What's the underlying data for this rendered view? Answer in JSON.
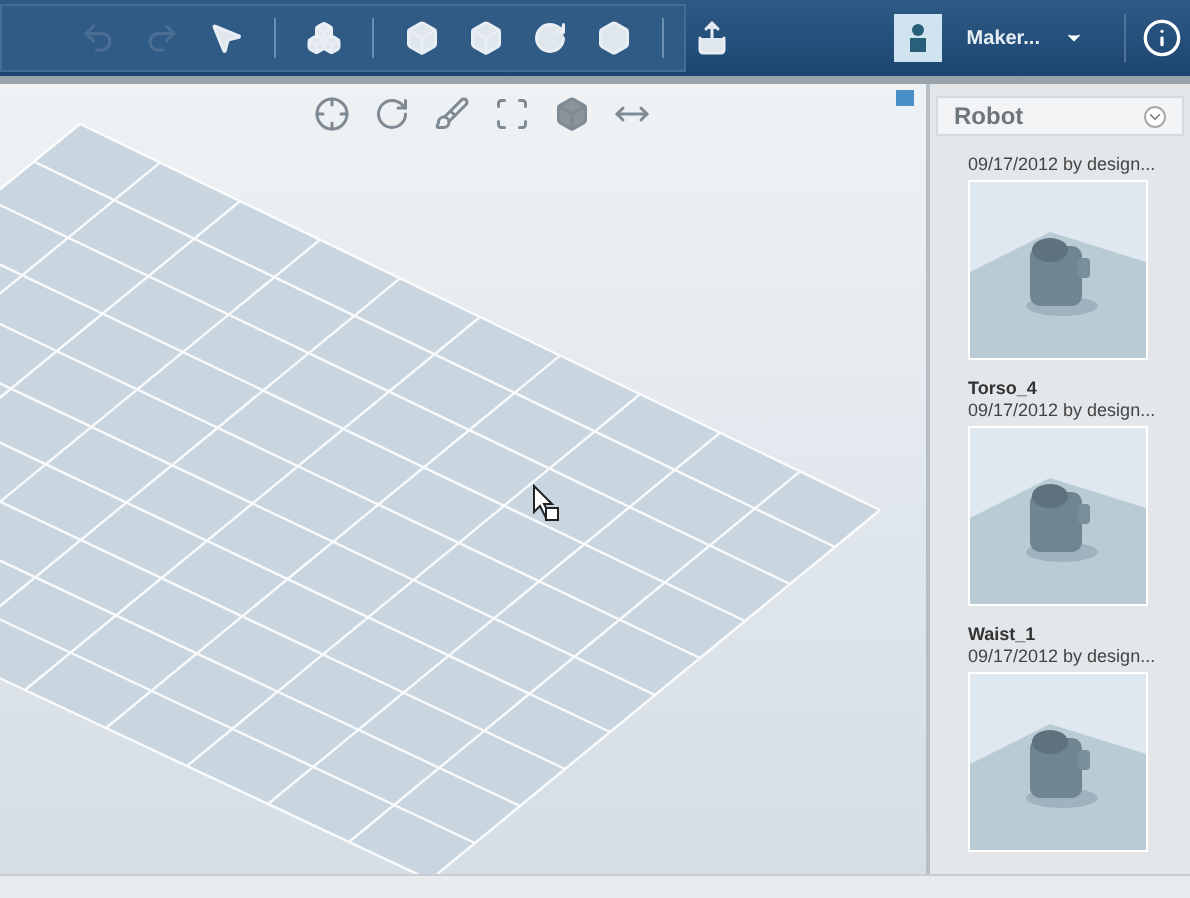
{
  "toolbar": {
    "tools": [
      {
        "kind": "undo",
        "disabled": true
      },
      {
        "kind": "redo",
        "disabled": true
      },
      {
        "kind": "select",
        "disabled": false
      },
      {
        "kind": "separator"
      },
      {
        "kind": "primitive",
        "disabled": false
      },
      {
        "kind": "separator"
      },
      {
        "kind": "extrude",
        "disabled": false
      },
      {
        "kind": "tweak",
        "disabled": false
      },
      {
        "kind": "rotate",
        "disabled": false
      },
      {
        "kind": "hexagon",
        "disabled": false
      },
      {
        "kind": "separator"
      },
      {
        "kind": "export",
        "disabled": false
      }
    ]
  },
  "user": {
    "name": "Maker..."
  },
  "panel": {
    "title": "Robot",
    "items": [
      {
        "date": "09/17/2012 by design..."
      },
      {
        "name": "Torso_4",
        "date": "09/17/2012 by design..."
      },
      {
        "name": "Waist_1",
        "date": "09/17/2012 by design..."
      }
    ]
  }
}
